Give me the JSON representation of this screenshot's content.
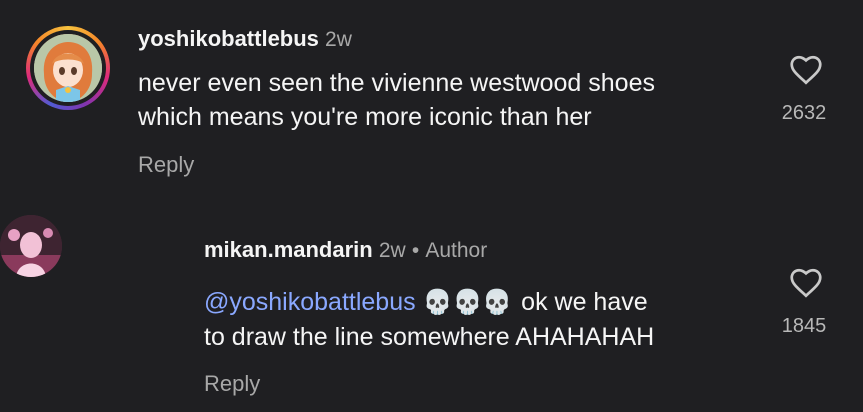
{
  "comments": [
    {
      "username": "yoshikobattlebus",
      "time": "2w",
      "text_line1": "never even seen the vivienne westwood shoes",
      "text_line2": "which means you're more iconic than her",
      "reply_label": "Reply",
      "likes": "2632",
      "avatar_icon": "anime-girl-avatar"
    },
    {
      "username": "mikan.mandarin",
      "time": "2w",
      "separator": "•",
      "author_badge": "Author",
      "mention": "@yoshikobattlebus",
      "emoji": "💀💀💀",
      "text_line1_rest": "ok we have",
      "text_line2": "to draw the line somewhere AHAHAHAH",
      "reply_label": "Reply",
      "likes": "1845",
      "avatar_icon": "pink-portrait-avatar"
    }
  ],
  "colors": {
    "background": "#1f1f22",
    "text": "#f5f5f5",
    "meta": "#a8a8a8",
    "mention": "#8aa8ff"
  }
}
